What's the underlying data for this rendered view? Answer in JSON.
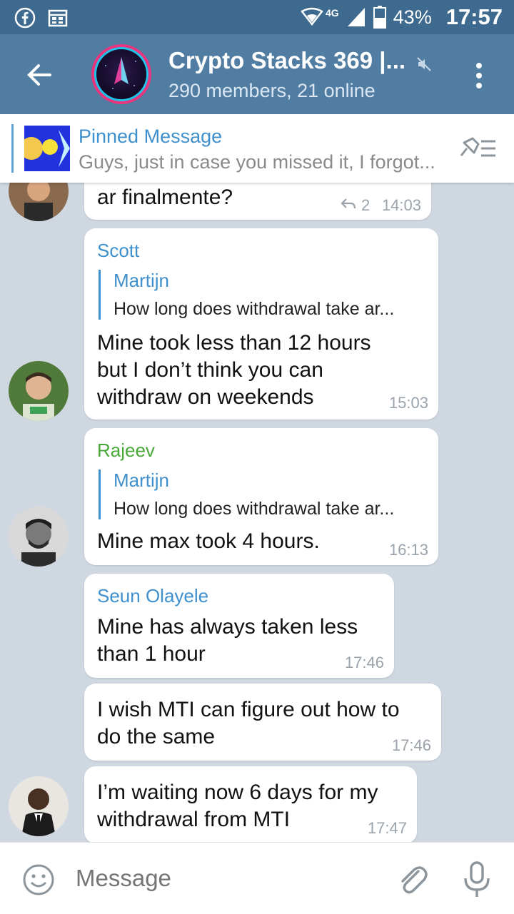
{
  "status_bar": {
    "network": "4G",
    "battery": "43%",
    "time": "17:57"
  },
  "header": {
    "title": "Crypto Stacks 369 |...",
    "subtitle": "290 members, 21 online"
  },
  "pinned": {
    "title": "Pinned Message",
    "text": "Guys, just in case you missed it, I forgot..."
  },
  "messages": [
    {
      "text": "ar finalmente?",
      "replies": "2",
      "time": "14:03"
    },
    {
      "sender": "Scott",
      "sender_color": "#3f90cc",
      "reply_to_name": "Martijn",
      "reply_to_text": "How long does withdrawal take ar...",
      "lines": [
        "Mine took less than 12 hours",
        "but I don’t think you can",
        "withdraw on weekends"
      ],
      "time": "15:03"
    },
    {
      "sender": "Rajeev",
      "sender_color": "#49a938",
      "reply_to_name": "Martijn",
      "reply_to_text": "How long does withdrawal take ar...",
      "lines": [
        "Mine max took 4 hours."
      ],
      "time": "16:13"
    },
    {
      "sender": "Seun Olayele",
      "sender_color": "#3f90cc",
      "lines": [
        "Mine has always taken less",
        "than 1 hour"
      ],
      "time": "17:46"
    },
    {
      "lines": [
        "I wish MTI can figure out how to",
        "do the same"
      ],
      "time": "17:46"
    },
    {
      "lines": [
        "I’m waiting now 6 days for my",
        "withdrawal from MTI"
      ],
      "time": "17:47"
    }
  ],
  "composer": {
    "placeholder": "Message"
  }
}
